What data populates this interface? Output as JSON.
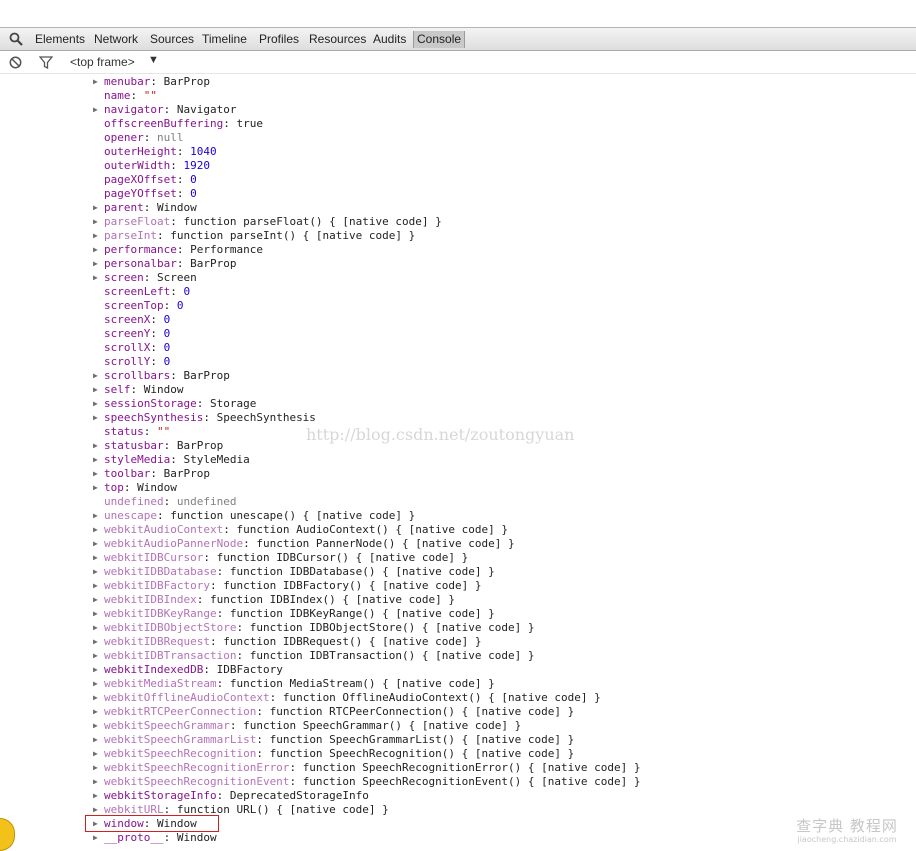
{
  "toolbar": {
    "tabs": [
      {
        "label": "Elements"
      },
      {
        "label": "Network"
      },
      {
        "label": "Sources"
      },
      {
        "label": "Timeline"
      },
      {
        "label": "Profiles"
      },
      {
        "label": "Resources"
      },
      {
        "label": "Audits"
      },
      {
        "label": "Console"
      }
    ],
    "active_tab": "Console"
  },
  "statusbar": {
    "frame_selector": "<top frame>",
    "caret": "▼"
  },
  "console": {
    "rows": [
      {
        "key": "menubar",
        "value": "BarProp",
        "expandable": true,
        "key_style": "k",
        "value_style": "v"
      },
      {
        "key": "name",
        "value": "\"\"",
        "expandable": false,
        "key_style": "k",
        "value_style": "s"
      },
      {
        "key": "navigator",
        "value": "Navigator",
        "expandable": true,
        "key_style": "k",
        "value_style": "v"
      },
      {
        "key": "offscreenBuffering",
        "value": "true",
        "expandable": false,
        "key_style": "k",
        "value_style": "v"
      },
      {
        "key": "opener",
        "value": "null",
        "expandable": false,
        "key_style": "k",
        "value_style": "g"
      },
      {
        "key": "outerHeight",
        "value": "1040",
        "expandable": false,
        "key_style": "k",
        "value_style": "n"
      },
      {
        "key": "outerWidth",
        "value": "1920",
        "expandable": false,
        "key_style": "k",
        "value_style": "n"
      },
      {
        "key": "pageXOffset",
        "value": "0",
        "expandable": false,
        "key_style": "k",
        "value_style": "n"
      },
      {
        "key": "pageYOffset",
        "value": "0",
        "expandable": false,
        "key_style": "k",
        "value_style": "n"
      },
      {
        "key": "parent",
        "value": "Window",
        "expandable": true,
        "key_style": "k",
        "value_style": "v"
      },
      {
        "key": "parseFloat",
        "value": "function parseFloat() { [native code] }",
        "expandable": true,
        "key_style": "k dim",
        "value_style": "v"
      },
      {
        "key": "parseInt",
        "value": "function parseInt() { [native code] }",
        "expandable": true,
        "key_style": "k dim",
        "value_style": "v"
      },
      {
        "key": "performance",
        "value": "Performance",
        "expandable": true,
        "key_style": "k",
        "value_style": "v"
      },
      {
        "key": "personalbar",
        "value": "BarProp",
        "expandable": true,
        "key_style": "k",
        "value_style": "v"
      },
      {
        "key": "screen",
        "value": "Screen",
        "expandable": true,
        "key_style": "k",
        "value_style": "v"
      },
      {
        "key": "screenLeft",
        "value": "0",
        "expandable": false,
        "key_style": "k",
        "value_style": "n"
      },
      {
        "key": "screenTop",
        "value": "0",
        "expandable": false,
        "key_style": "k",
        "value_style": "n"
      },
      {
        "key": "screenX",
        "value": "0",
        "expandable": false,
        "key_style": "k",
        "value_style": "n"
      },
      {
        "key": "screenY",
        "value": "0",
        "expandable": false,
        "key_style": "k",
        "value_style": "n"
      },
      {
        "key": "scrollX",
        "value": "0",
        "expandable": false,
        "key_style": "k",
        "value_style": "n"
      },
      {
        "key": "scrollY",
        "value": "0",
        "expandable": false,
        "key_style": "k",
        "value_style": "n"
      },
      {
        "key": "scrollbars",
        "value": "BarProp",
        "expandable": true,
        "key_style": "k",
        "value_style": "v"
      },
      {
        "key": "self",
        "value": "Window",
        "expandable": true,
        "key_style": "k",
        "value_style": "v"
      },
      {
        "key": "sessionStorage",
        "value": "Storage",
        "expandable": true,
        "key_style": "k",
        "value_style": "v"
      },
      {
        "key": "speechSynthesis",
        "value": "SpeechSynthesis",
        "expandable": true,
        "key_style": "k",
        "value_style": "v"
      },
      {
        "key": "status",
        "value": "\"\"",
        "expandable": false,
        "key_style": "k",
        "value_style": "s"
      },
      {
        "key": "statusbar",
        "value": "BarProp",
        "expandable": true,
        "key_style": "k",
        "value_style": "v"
      },
      {
        "key": "styleMedia",
        "value": "StyleMedia",
        "expandable": true,
        "key_style": "k",
        "value_style": "v"
      },
      {
        "key": "toolbar",
        "value": "BarProp",
        "expandable": true,
        "key_style": "k",
        "value_style": "v"
      },
      {
        "key": "top",
        "value": "Window",
        "expandable": true,
        "key_style": "k",
        "value_style": "v"
      },
      {
        "key": "undefined",
        "value": "undefined",
        "expandable": false,
        "key_style": "k dim",
        "value_style": "g"
      },
      {
        "key": "unescape",
        "value": "function unescape() { [native code] }",
        "expandable": true,
        "key_style": "k dim",
        "value_style": "v"
      },
      {
        "key": "webkitAudioContext",
        "value": "function AudioContext() { [native code] }",
        "expandable": true,
        "key_style": "k dim",
        "value_style": "v"
      },
      {
        "key": "webkitAudioPannerNode",
        "value": "function PannerNode() { [native code] }",
        "expandable": true,
        "key_style": "k dim",
        "value_style": "v"
      },
      {
        "key": "webkitIDBCursor",
        "value": "function IDBCursor() { [native code] }",
        "expandable": true,
        "key_style": "k dim",
        "value_style": "v"
      },
      {
        "key": "webkitIDBDatabase",
        "value": "function IDBDatabase() { [native code] }",
        "expandable": true,
        "key_style": "k dim",
        "value_style": "v"
      },
      {
        "key": "webkitIDBFactory",
        "value": "function IDBFactory() { [native code] }",
        "expandable": true,
        "key_style": "k dim",
        "value_style": "v"
      },
      {
        "key": "webkitIDBIndex",
        "value": "function IDBIndex() { [native code] }",
        "expandable": true,
        "key_style": "k dim",
        "value_style": "v"
      },
      {
        "key": "webkitIDBKeyRange",
        "value": "function IDBKeyRange() { [native code] }",
        "expandable": true,
        "key_style": "k dim",
        "value_style": "v"
      },
      {
        "key": "webkitIDBObjectStore",
        "value": "function IDBObjectStore() { [native code] }",
        "expandable": true,
        "key_style": "k dim",
        "value_style": "v"
      },
      {
        "key": "webkitIDBRequest",
        "value": "function IDBRequest() { [native code] }",
        "expandable": true,
        "key_style": "k dim",
        "value_style": "v"
      },
      {
        "key": "webkitIDBTransaction",
        "value": "function IDBTransaction() { [native code] }",
        "expandable": true,
        "key_style": "k dim",
        "value_style": "v"
      },
      {
        "key": "webkitIndexedDB",
        "value": "IDBFactory",
        "expandable": true,
        "key_style": "k",
        "value_style": "v"
      },
      {
        "key": "webkitMediaStream",
        "value": "function MediaStream() { [native code] }",
        "expandable": true,
        "key_style": "k dim",
        "value_style": "v"
      },
      {
        "key": "webkitOfflineAudioContext",
        "value": "function OfflineAudioContext() { [native code] }",
        "expandable": true,
        "key_style": "k dim",
        "value_style": "v"
      },
      {
        "key": "webkitRTCPeerConnection",
        "value": "function RTCPeerConnection() { [native code] }",
        "expandable": true,
        "key_style": "k dim",
        "value_style": "v"
      },
      {
        "key": "webkitSpeechGrammar",
        "value": "function SpeechGrammar() { [native code] }",
        "expandable": true,
        "key_style": "k dim",
        "value_style": "v"
      },
      {
        "key": "webkitSpeechGrammarList",
        "value": "function SpeechGrammarList() { [native code] }",
        "expandable": true,
        "key_style": "k dim",
        "value_style": "v"
      },
      {
        "key": "webkitSpeechRecognition",
        "value": "function SpeechRecognition() { [native code] }",
        "expandable": true,
        "key_style": "k dim",
        "value_style": "v"
      },
      {
        "key": "webkitSpeechRecognitionError",
        "value": "function SpeechRecognitionError() { [native code] }",
        "expandable": true,
        "key_style": "k dim",
        "value_style": "v"
      },
      {
        "key": "webkitSpeechRecognitionEvent",
        "value": "function SpeechRecognitionEvent() { [native code] }",
        "expandable": true,
        "key_style": "k dim",
        "value_style": "v"
      },
      {
        "key": "webkitStorageInfo",
        "value": "DeprecatedStorageInfo",
        "expandable": true,
        "key_style": "k",
        "value_style": "v"
      },
      {
        "key": "webkitURL",
        "value": "function URL() { [native code] }",
        "expandable": true,
        "key_style": "k dim",
        "value_style": "v"
      },
      {
        "key": "window",
        "value": "Window",
        "expandable": true,
        "key_style": "k",
        "value_style": "v"
      },
      {
        "key": "__proto__",
        "value": "Window",
        "expandable": true,
        "key_style": "k",
        "value_style": "v"
      }
    ]
  },
  "watermark": {
    "text": "http://blog.csdn.net/zoutongyuan"
  },
  "site_watermark": {
    "title": "查字典 教程网",
    "url": "jiaocheng.chazidian.com"
  },
  "colors": {
    "key": "#881391",
    "key_dim": "#b472b9",
    "number": "#1c00cf",
    "string": "#c41a16",
    "highlight_border": "#d21f1f"
  }
}
